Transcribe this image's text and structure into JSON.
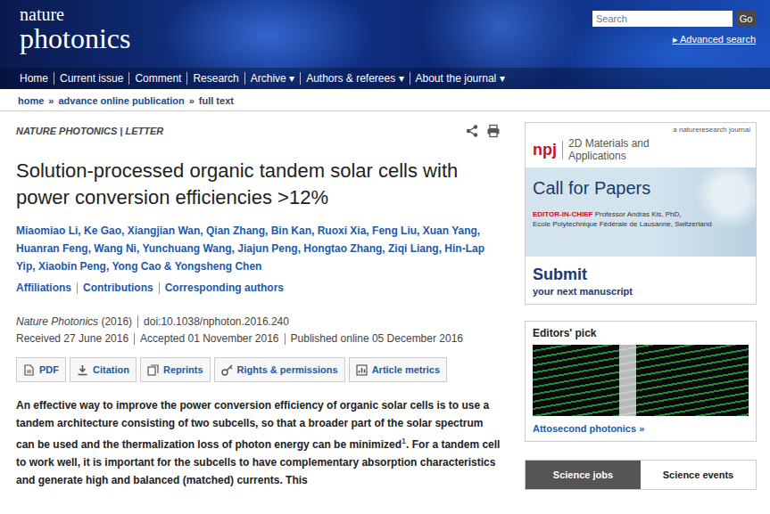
{
  "header": {
    "logo": {
      "line1": "nature",
      "line2": "photonics"
    },
    "search": {
      "placeholder": "Search",
      "button": "Go"
    },
    "advanced_search": "▸ Advanced search",
    "nav": [
      {
        "label": "Home"
      },
      {
        "label": "Current issue"
      },
      {
        "label": "Comment"
      },
      {
        "label": "Research"
      },
      {
        "label": "Archive ▾"
      },
      {
        "label": "Authors & referees ▾"
      },
      {
        "label": "About the journal ▾"
      }
    ]
  },
  "breadcrumb": [
    {
      "text": "home",
      "link": true
    },
    {
      "text": "»",
      "link": false
    },
    {
      "text": "advance online publication",
      "link": true
    },
    {
      "text": "»",
      "link": false
    },
    {
      "text": "full text",
      "link": false
    }
  ],
  "article": {
    "label": "NATURE PHOTONICS | LETTER",
    "title": "Solution-processed organic tandem solar cells with power conversion efficiencies >12%",
    "authors": [
      "Miaomiao Li,",
      "Ke Gao,",
      "Xiangjian Wan,",
      "Qian Zhang,",
      "Bin Kan,",
      "Ruoxi Xia,",
      "Feng Liu,",
      "Xuan Yang,",
      "Huanran Feng,",
      "Wang Ni,",
      "Yunchuang Wang,",
      "Jiajun Peng,",
      "Hongtao Zhang,",
      "Ziqi Liang,",
      "Hin-Lap Yip,",
      "Xiaobin Peng,",
      "Yong Cao",
      "&",
      "Yongsheng Chen"
    ],
    "links": [
      "Affiliations",
      "Contributions",
      "Corresponding authors"
    ],
    "citation": {
      "journal": "Nature Photonics",
      "year": "(2016)",
      "doi": "doi:10.1038/nphoton.2016.240"
    },
    "dates": [
      "Received 27 June 2016",
      "Accepted 01 November 2016",
      "Published online 05 December 2016"
    ],
    "buttons": [
      {
        "label": "PDF",
        "kind": "pdf"
      },
      {
        "label": "Citation",
        "kind": "download"
      },
      {
        "label": "Reprints",
        "kind": "reprints"
      },
      {
        "label": "Rights & permissions",
        "kind": "rights"
      },
      {
        "label": "Article metrics",
        "kind": "metrics"
      }
    ],
    "abstract": {
      "before": "An effective way to improve the power conversion efficiency of organic solar cells is to use a tandem architecture consisting of two subcells, so that a broader part of the solar spectrum can be used and the thermalization loss of photon energy can be minimized",
      "ref": "1",
      "after": ". For a tandem cell to work well, it is important for the subcells to have complementary absorption characteristics and generate high and balanced (matched) currents. This"
    }
  },
  "sidebar": {
    "ad": {
      "publisher": "a natureresearch journal",
      "brand": "npj",
      "journal": "2D Materials and Applications",
      "headline": "Call for Papers",
      "editor_label": "EDITOR-IN-CHIEF",
      "editor_line1": "Professor Andras Kis, PhD,",
      "editor_line2": "Ecole Polytechnique Fédérale de Lausanne, Switzerland",
      "submit": "Submit",
      "submit_sub": "your next manuscript"
    },
    "editors_pick": {
      "title": "Editors' pick",
      "link": "Attosecond photonics »"
    },
    "tabs": [
      {
        "label": "Science jobs",
        "selected": true
      },
      {
        "label": "Science events",
        "selected": false
      }
    ]
  }
}
